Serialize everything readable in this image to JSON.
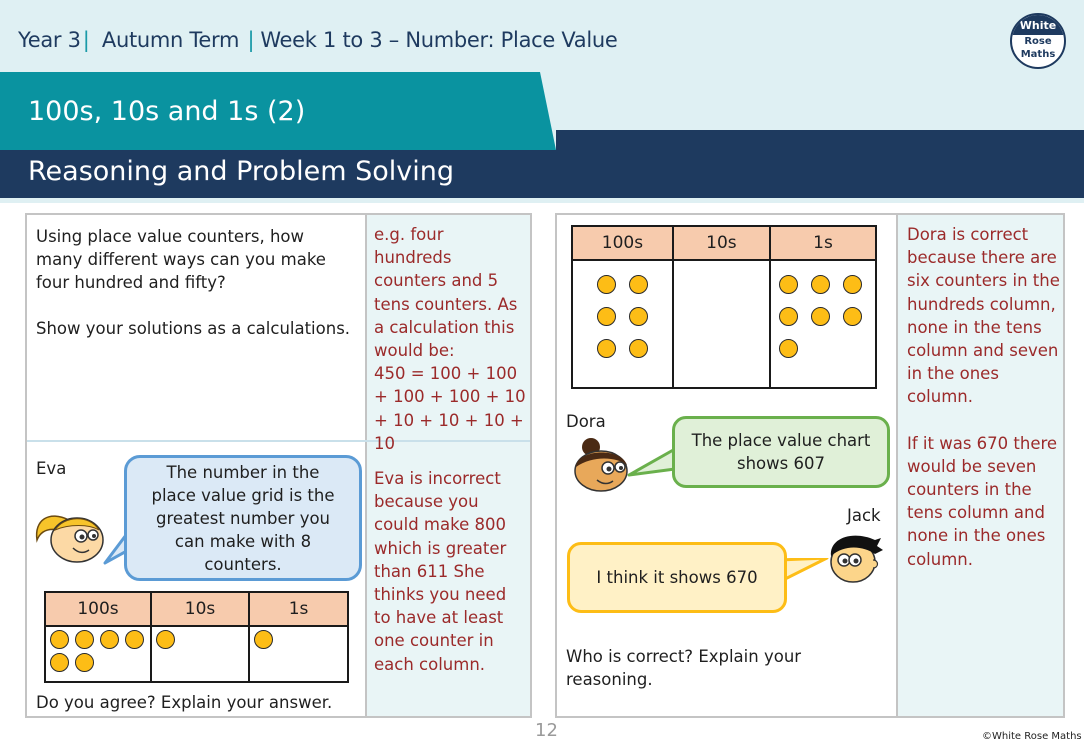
{
  "header": {
    "breadcrumb": {
      "year": "Year 3",
      "term": "Autumn Term",
      "unit": "Week 1 to 3 – Number: Place Value"
    },
    "lesson_title": "100s, 10s and 1s (2)",
    "section_title": "Reasoning and Problem Solving",
    "logo": {
      "line1": "White",
      "line2": "Rose",
      "line3": "Maths"
    }
  },
  "colors": {
    "teal": "#0a93a0",
    "navy": "#1e3a5f",
    "light_band": "#dff0f3",
    "answer_red": "#9b2a2a",
    "answer_bg": "#e9f5f6",
    "counter": "#fdbd16",
    "table_header": "#f7cbad"
  },
  "left_panel": {
    "question1": {
      "text": "Using place value counters, how many different ways can you make four hundred and fifty?",
      "instruction": "Show your solutions as a calculations.",
      "answer": [
        "e.g. four hundreds counters and 5 tens counters. As a calculation this would be:",
        "450 = 100 + 100 + 100 + 100 + 10 + 10 + 10 + 10 + 10"
      ]
    },
    "question2": {
      "character": "Eva",
      "speech": "The number in the place value grid is the greatest number you can make with 8 counters.",
      "table": {
        "headers": [
          "100s",
          "10s",
          "1s"
        ],
        "counters": {
          "hundreds": 6,
          "tens": 1,
          "ones": 1
        }
      },
      "prompt": "Do you agree? Explain your answer.",
      "answer": "Eva is incorrect because you could make 800 which is greater than 611 She thinks you need to have at least one counter in each column."
    }
  },
  "right_panel": {
    "table": {
      "headers": [
        "100s",
        "10s",
        "1s"
      ],
      "counters": {
        "hundreds": 6,
        "tens": 0,
        "ones": 7
      }
    },
    "dora": {
      "name": "Dora",
      "speech": "The place value chart shows 607"
    },
    "jack": {
      "name": "Jack",
      "speech": "I think it shows 670"
    },
    "prompt": "Who is correct? Explain your reasoning.",
    "answer": [
      "Dora is correct because there are six counters in the hundreds column, none in the tens column and seven in the ones column.",
      "If it was 670 there would be seven counters in the tens column and none in the ones column."
    ]
  },
  "footer": {
    "page_number": "12",
    "copyright": "©White Rose Maths"
  }
}
